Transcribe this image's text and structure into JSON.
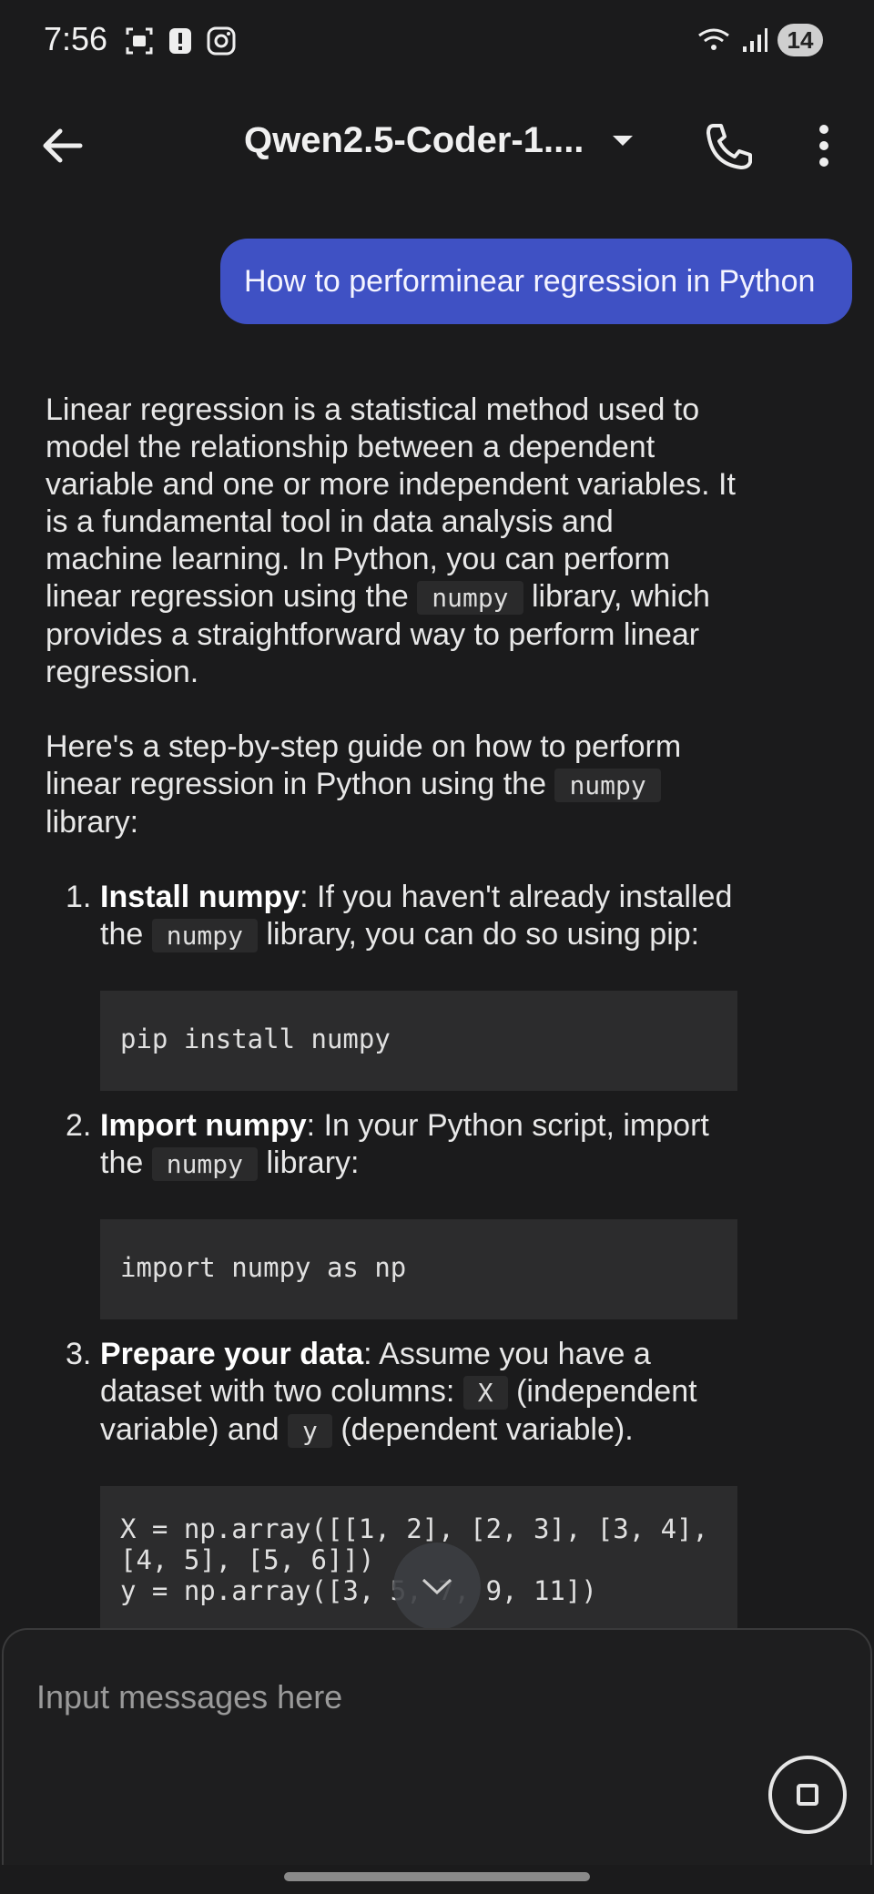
{
  "status_bar": {
    "time": "7:56",
    "battery": "14",
    "icons_left": [
      "screenshot-icon",
      "alert-icon",
      "instagram-icon"
    ],
    "icons_right": [
      "wifi-icon",
      "signal-icon"
    ]
  },
  "app_bar": {
    "title": "Qwen2.5-Coder-1...."
  },
  "user_message": "How to performinear regression in Python",
  "response": {
    "p1_a": "Linear regression is a statistical method used to model the relationship between a dependent variable and one or more independent variables. It is a fundamental tool in data analysis and machine learning. In Python, you can perform linear regression using the",
    "p1_code": "numpy",
    "p1_b": "library, which provides a straightforward way to perform linear regression.",
    "p2_a": "Here's a step-by-step guide on how to perform linear regression in Python using the",
    "p2_code": "numpy",
    "p2_b": "library:",
    "steps": [
      {
        "num": "1.",
        "bold": "Install numpy",
        "text_a": ": If you haven't already installed the",
        "code": "numpy",
        "text_b": "library, you can do so using pip:",
        "block": "pip install numpy"
      },
      {
        "num": "2.",
        "bold": "Import numpy",
        "text_a": ": In your Python script, import the",
        "code": "numpy",
        "text_b": "library:",
        "block": "import numpy as np"
      },
      {
        "num": "3.",
        "bold": "Prepare your data",
        "text_a": ": Assume you have a dataset with two columns:",
        "code": "X",
        "text_mid": "(independent variable) and",
        "code2": "y",
        "text_b": "(dependent variable).",
        "block_line1": "X = np.array([[1, 2], [2, 3], [3, 4],",
        "block_line2": "[4, 5], [5, 6]])",
        "block_line3": "y = np.array([3, 5, 7, 9, 11])"
      }
    ]
  },
  "input": {
    "placeholder": "Input messages here"
  }
}
